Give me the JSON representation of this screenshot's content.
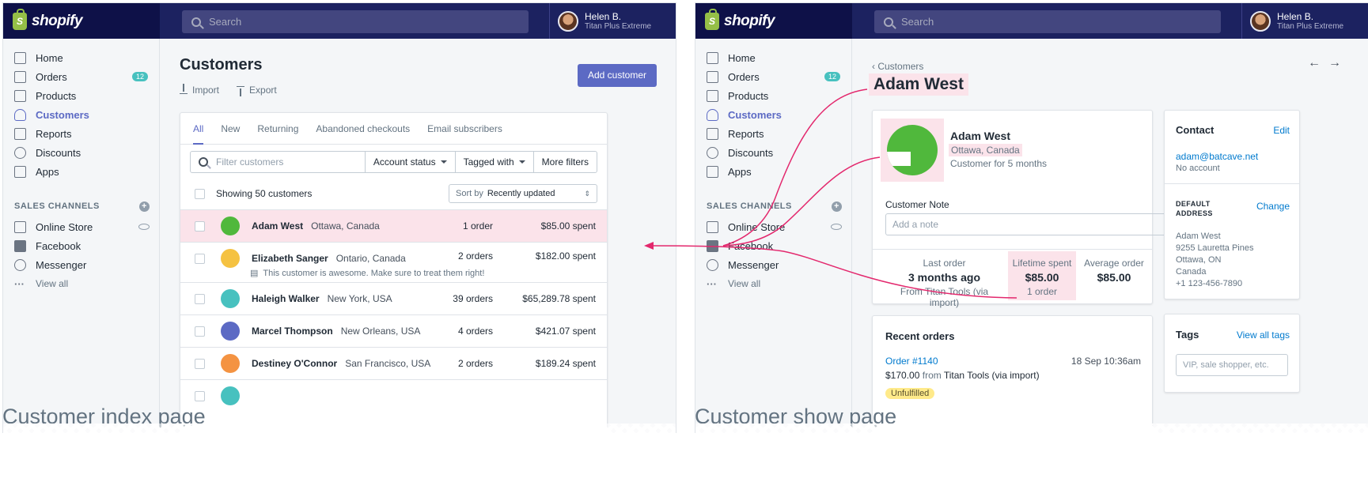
{
  "topbar": {
    "brand": "shopify",
    "search_placeholder": "Search",
    "user_name": "Helen B.",
    "user_store": "Titan Plus Extreme"
  },
  "nav": {
    "home": "Home",
    "orders": "Orders",
    "orders_badge": "12",
    "products": "Products",
    "customers": "Customers",
    "reports": "Reports",
    "discounts": "Discounts",
    "apps": "Apps",
    "channels_heading": "SALES CHANNELS",
    "online_store": "Online Store",
    "facebook": "Facebook",
    "messenger": "Messenger",
    "view_all": "View all"
  },
  "index": {
    "title": "Customers",
    "import": "Import",
    "export": "Export",
    "add_customer": "Add customer",
    "tabs": [
      "All",
      "New",
      "Returning",
      "Abandoned checkouts",
      "Email subscribers"
    ],
    "filter_placeholder": "Filter customers",
    "account_status": "Account status",
    "tagged_with": "Tagged with",
    "more_filters": "More filters",
    "showing": "Showing 50 customers",
    "sort_by": "Sort by",
    "sort_value": "Recently updated",
    "rows": [
      {
        "name": "Adam West",
        "location": "Ottawa, Canada",
        "orders": "1 order",
        "spent": "$85.00 spent",
        "color": "#50b83c"
      },
      {
        "name": "Elizabeth Sanger",
        "location": "Ontario, Canada",
        "orders": "2 orders",
        "spent": "$182.00 spent",
        "note": "This customer is awesome. Make sure to treat them right!",
        "color": "#f5c242"
      },
      {
        "name": "Haleigh Walker",
        "location": "New York, USA",
        "orders": "39 orders",
        "spent": "$65,289.78 spent",
        "color": "#47c1bf"
      },
      {
        "name": "Marcel Thompson",
        "location": "New Orleans, USA",
        "orders": "4 orders",
        "spent": "$421.07 spent",
        "color": "#5c6ac4"
      },
      {
        "name": "Destiney O'Connor",
        "location": "San Francisco, USA",
        "orders": "2 orders",
        "spent": "$189.24 spent",
        "color": "#f49342"
      }
    ]
  },
  "show": {
    "breadcrumb": "Customers",
    "name": "Adam West",
    "location": "Ottawa, Canada",
    "since": "Customer for 5 months",
    "note_label": "Customer Note",
    "note_placeholder": "Add a note",
    "last_order_label": "Last order",
    "last_order_value": "3 months ago",
    "last_order_sub": "From Titan Tools (via import)",
    "lifetime_label": "Lifetime spent",
    "lifetime_value": "$85.00",
    "lifetime_sub": "1 order",
    "average_label": "Average order",
    "average_value": "$85.00",
    "contact_heading": "Contact",
    "edit": "Edit",
    "email": "adam@batcave.net",
    "account": "No account",
    "default_address_heading": "DEFAULT ADDRESS",
    "change": "Change",
    "address_lines": [
      "Adam West",
      "9255 Lauretta Pines",
      "Ottawa, ON",
      "Canada",
      "+1 123-456-7890"
    ],
    "recent_orders_heading": "Recent orders",
    "order_number": "Order #1140",
    "order_date": "18 Sep 10:36am",
    "order_amount": "$170.00",
    "order_from": "from",
    "order_source": "Titan Tools (via import)",
    "order_status": "Unfulfilled",
    "tags_heading": "Tags",
    "view_all_tags": "View all tags",
    "tags_placeholder": "VIP, sale shopper, etc."
  },
  "captions": {
    "left": "Customer index page",
    "right": "Customer show page"
  },
  "colors": {
    "topbar": "#1c2260",
    "accent": "#5c6ac4",
    "highlight": "#fbe3ea",
    "annotation": "#e3286d"
  }
}
